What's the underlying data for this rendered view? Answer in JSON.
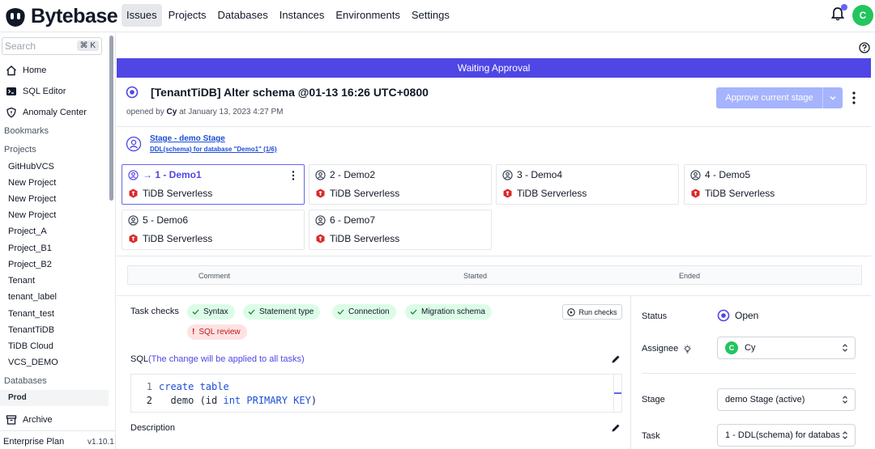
{
  "brand": {
    "name": "Bytebase"
  },
  "nav": {
    "items": [
      "Issues",
      "Projects",
      "Databases",
      "Instances",
      "Environments",
      "Settings"
    ],
    "active": "Issues"
  },
  "user": {
    "initial": "C"
  },
  "sidebar": {
    "search_placeholder": "Search",
    "shortcut": "⌘ K",
    "main_items": [
      "Home",
      "SQL Editor",
      "Anomaly Center"
    ],
    "bookmarks_heading": "Bookmarks",
    "projects_heading": "Projects",
    "projects": [
      "GitHubVCS",
      "New Project",
      "New Project",
      "New Project",
      "Project_A",
      "Project_B1",
      "Project_B2",
      "Tenant",
      "tenant_label",
      "Tenant_test",
      "TenantTiDB",
      "TiDB Cloud",
      "VCS_DEMO"
    ],
    "databases_heading": "Databases",
    "env": "Prod",
    "archive": "Archive",
    "plan": "Enterprise Plan",
    "version": "v1.10.1"
  },
  "issue": {
    "banner": "Waiting Approval",
    "title": "[TenantTiDB] Alter schema @01-13 16:26 UTC+0800",
    "opened_prefix": "opened by",
    "author": "Cy",
    "opened_suffix": "at January 13, 2023 4:27 PM",
    "approve_label": "Approve current stage"
  },
  "stage": {
    "link": "Stage - demo Stage",
    "subtitle": "DDL(schema) for database \"Demo1\" (1/6)"
  },
  "tasks": [
    {
      "name": "→ 1 - Demo1",
      "db": "TiDB Serverless"
    },
    {
      "name": "2 - Demo2",
      "db": "TiDB Serverless"
    },
    {
      "name": "3 - Demo4",
      "db": "TiDB Serverless"
    },
    {
      "name": "4 - Demo5",
      "db": "TiDB Serverless"
    },
    {
      "name": "5 - Demo6",
      "db": "TiDB Serverless"
    },
    {
      "name": "6 - Demo7",
      "db": "TiDB Serverless"
    }
  ],
  "table_headers": [
    "Comment",
    "Started",
    "Ended"
  ],
  "checks": {
    "label": "Task checks",
    "passed": [
      "Syntax",
      "Statement type",
      "Connection",
      "Migration schema"
    ],
    "failed": "SQL review",
    "run_label": "Run checks"
  },
  "sql": {
    "label": "SQL",
    "note": "(The change will be applied to all tasks)",
    "lines": [
      {
        "n": "1",
        "kw": "create table",
        "rest": ""
      },
      {
        "n": "2",
        "pre": "  demo (id ",
        "kw": "int PRIMARY KEY",
        "post": ")"
      }
    ]
  },
  "description_label": "Description",
  "panel": {
    "status_label": "Status",
    "status_value": "Open",
    "assignee_label": "Assignee",
    "assignee_value": "Cy",
    "stage_label": "Stage",
    "stage_value": "demo Stage (active)",
    "task_label": "Task",
    "task_value": "1 - DDL(schema) for databas"
  },
  "colors": {
    "accent": "#4f46e5",
    "success": "#22c55e",
    "danger": "#dc2626"
  }
}
